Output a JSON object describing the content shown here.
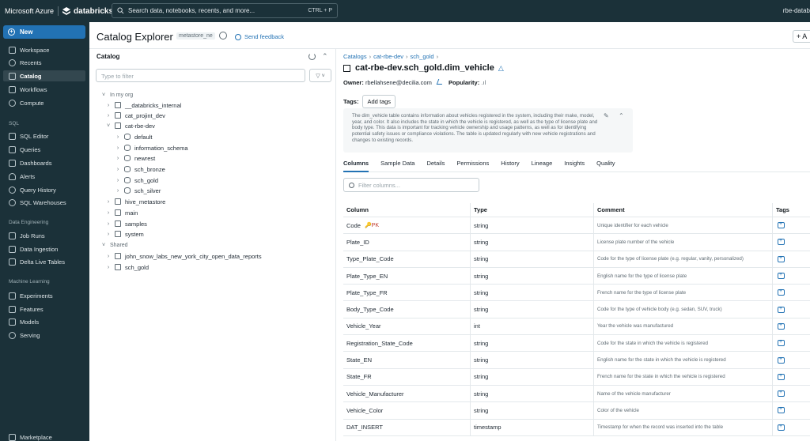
{
  "topbar": {
    "brand": "Microsoft Azure",
    "product": "databricks",
    "search_placeholder": "Search data, notebooks, recents, and more...",
    "search_shortcut": "CTRL + P",
    "user": "rbe-datab"
  },
  "sidebar": {
    "new_label": "New",
    "items": [
      {
        "label": "Workspace"
      },
      {
        "label": "Recents"
      },
      {
        "label": "Catalog"
      },
      {
        "label": "Workflows"
      },
      {
        "label": "Compute"
      }
    ],
    "sql_section": "SQL",
    "sql_items": [
      {
        "label": "SQL Editor"
      },
      {
        "label": "Queries"
      },
      {
        "label": "Dashboards"
      },
      {
        "label": "Alerts"
      },
      {
        "label": "Query History"
      },
      {
        "label": "SQL Warehouses"
      }
    ],
    "de_section": "Data Engineering",
    "de_items": [
      {
        "label": "Job Runs"
      },
      {
        "label": "Data Ingestion"
      },
      {
        "label": "Delta Live Tables"
      }
    ],
    "ml_section": "Machine Learning",
    "ml_items": [
      {
        "label": "Experiments"
      },
      {
        "label": "Features"
      },
      {
        "label": "Models"
      },
      {
        "label": "Serving"
      }
    ],
    "marketplace": "Marketplace"
  },
  "header": {
    "title": "Catalog Explorer",
    "metastore": "metastore_ne",
    "feedback": "Send feedback",
    "add_label": "+ A"
  },
  "catalog_pane": {
    "title": "Catalog",
    "filter_placeholder": "Type to filter",
    "filter_button": "▽ ˅",
    "group_my_org": "In my org",
    "my_org": [
      {
        "label": "__databricks_internal",
        "expanded": false
      },
      {
        "label": "cat_projint_dev",
        "expanded": false
      },
      {
        "label": "cat-rbe-dev",
        "expanded": true
      },
      {
        "label": "hive_metastore",
        "expanded": false
      },
      {
        "label": "main",
        "expanded": false
      },
      {
        "label": "samples",
        "expanded": false
      },
      {
        "label": "system",
        "expanded": false
      }
    ],
    "schemas": [
      {
        "label": "default"
      },
      {
        "label": "information_schema"
      },
      {
        "label": "newrest"
      },
      {
        "label": "sch_bronze"
      },
      {
        "label": "sch_gold"
      },
      {
        "label": "sch_silver"
      }
    ],
    "group_shared": "Shared",
    "shared": [
      {
        "label": "john_snow_labs_new_york_city_open_data_reports"
      },
      {
        "label": "sch_gold"
      }
    ]
  },
  "detail": {
    "breadcrumb": [
      "Catalogs",
      "cat-rbe-dev",
      "sch_gold"
    ],
    "table_name": "cat-rbe-dev.sch_gold.dim_vehicle",
    "owner_label": "Owner:",
    "owner": "rbellahsene@decilia.com",
    "popularity_label": "Popularity:",
    "tags_label": "Tags:",
    "add_tags": "Add tags",
    "description": "The dim_vehicle table contains information about vehicles registered in the system, including their make, model, year, and color. It also includes the state in which the vehicle is registered, as well as the type of license plate and body type. This data is important for tracking vehicle ownership and usage patterns, as well as for identifying potential safety issues or compliance violations. The table is updated regularly with new vehicle registrations and changes to existing records.",
    "tabs": [
      "Columns",
      "Sample Data",
      "Details",
      "Permissions",
      "History",
      "Lineage",
      "Insights",
      "Quality"
    ],
    "column_filter_placeholder": "Filter columns...",
    "grid_headers": {
      "column": "Column",
      "type": "Type",
      "comment": "Comment",
      "tags": "Tags"
    },
    "columns": [
      {
        "name": "Code",
        "pk": "PK",
        "type": "string",
        "comment": "Unique identifier for each vehicle"
      },
      {
        "name": "Plate_ID",
        "type": "string",
        "comment": "License plate number of the vehicle"
      },
      {
        "name": "Type_Plate_Code",
        "type": "string",
        "comment": "Code for the type of license plate (e.g. regular, vanity, personalized)"
      },
      {
        "name": "Plate_Type_EN",
        "type": "string",
        "comment": "English name for the type of license plate"
      },
      {
        "name": "Plate_Type_FR",
        "type": "string",
        "comment": "French name for the type of license plate"
      },
      {
        "name": "Body_Type_Code",
        "type": "string",
        "comment": "Code for the type of vehicle body (e.g. sedan, SUV, truck)"
      },
      {
        "name": "Vehicle_Year",
        "type": "int",
        "comment": "Year the vehicle was manufactured"
      },
      {
        "name": "Registration_State_Code",
        "type": "string",
        "comment": "Code for the state in which the vehicle is registered"
      },
      {
        "name": "State_EN",
        "type": "string",
        "comment": "English name for the state in which the vehicle is registered"
      },
      {
        "name": "State_FR",
        "type": "string",
        "comment": "French name for the state in which the vehicle is registered"
      },
      {
        "name": "Vehicle_Manufacturer",
        "type": "string",
        "comment": "Name of the vehicle manufacturer"
      },
      {
        "name": "Vehicle_Color",
        "type": "string",
        "comment": "Color of the vehicle"
      },
      {
        "name": "DAT_INSERT",
        "type": "timestamp",
        "comment": "Timestamp for when the record was inserted into the table"
      }
    ]
  },
  "colors": {
    "accent": "#2272b4",
    "sidebar_bg": "#1b3139",
    "pk": "#c0392b"
  }
}
